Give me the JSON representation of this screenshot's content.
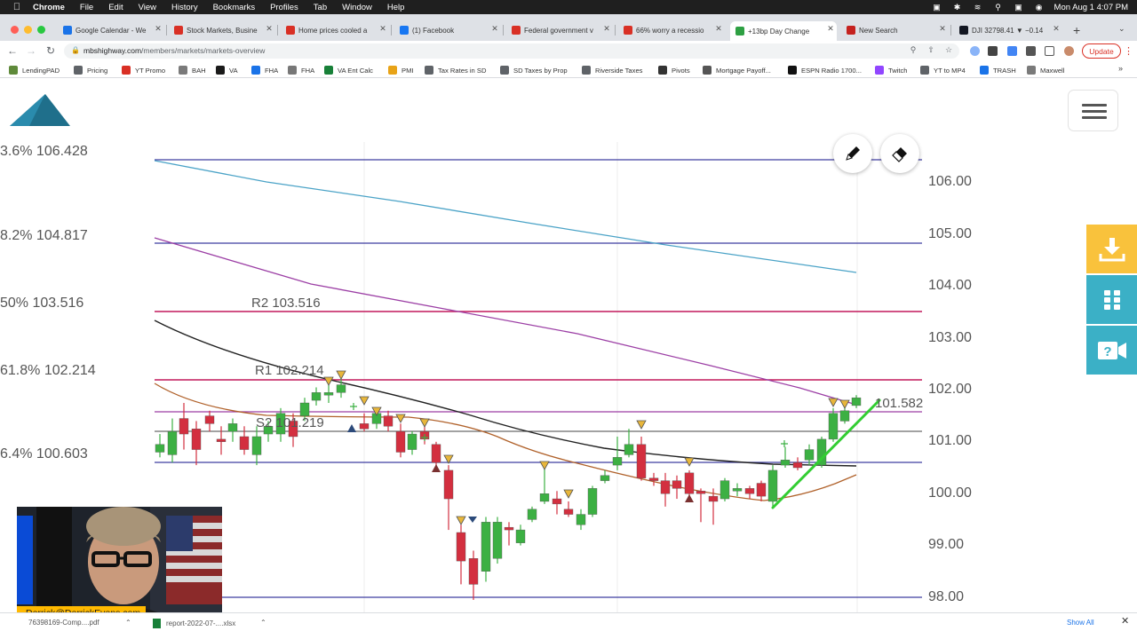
{
  "menubar": {
    "app": "Chrome",
    "items": [
      "File",
      "Edit",
      "View",
      "History",
      "Bookmarks",
      "Profiles",
      "Tab",
      "Window",
      "Help"
    ],
    "clock": "Mon Aug 1  4:07 PM"
  },
  "tabs": [
    {
      "label": "Google Calendar - We",
      "icon": "calendar-icon",
      "color": "#1a73e8"
    },
    {
      "label": "Stock Markets, Busine",
      "icon": "mbs-icon",
      "color": "#d93025"
    },
    {
      "label": "Home prices cooled a",
      "icon": "mbs-icon",
      "color": "#d93025"
    },
    {
      "label": "(1) Facebook",
      "icon": "facebook-icon",
      "color": "#1877f2"
    },
    {
      "label": "Federal government v",
      "icon": "mbs-icon",
      "color": "#d93025"
    },
    {
      "label": "66% worry a recessio",
      "icon": "mbs-icon",
      "color": "#d93025"
    },
    {
      "label": "+13bp Day Change",
      "icon": "house-icon",
      "color": "#2ea043"
    },
    {
      "label": "New Search",
      "icon": "search-house-icon",
      "color": "#c5221f"
    },
    {
      "label": "DJI 32798.41 ▼ −0.14",
      "icon": "tradingview-icon",
      "color": "#131722"
    }
  ],
  "active_tab_index": 6,
  "address": {
    "url_main": "mbshighway.com",
    "url_path": "/members/markets/markets-overview"
  },
  "update_label": "Update",
  "bookmarks": [
    {
      "label": "LendingPAD",
      "icon": "lendingpad-icon",
      "color": "#5f8a3a"
    },
    {
      "label": "Pricing",
      "icon": "globe-icon",
      "color": "#5f6368"
    },
    {
      "label": "YT Promo",
      "icon": "yt-promo-icon",
      "color": "#d93025"
    },
    {
      "label": "BAH",
      "icon": "folder-icon",
      "color": "#7a7a7a"
    },
    {
      "label": "VA",
      "icon": "va-icon",
      "color": "#1a1a1a"
    },
    {
      "label": "FHA",
      "icon": "house-icon",
      "color": "#1a73e8"
    },
    {
      "label": "FHA",
      "icon": "hud-icon",
      "color": "#777777"
    },
    {
      "label": "VA Ent Calc",
      "icon": "sheet-icon",
      "color": "#188038"
    },
    {
      "label": "PMI",
      "icon": "chart-icon",
      "color": "#e8a317"
    },
    {
      "label": "Tax Rates in SD",
      "icon": "globe-icon",
      "color": "#5f6368"
    },
    {
      "label": "SD Taxes by Prop",
      "icon": "globe-icon",
      "color": "#5f6368"
    },
    {
      "label": "Riverside Taxes",
      "icon": "circle-icon",
      "color": "#5f6368"
    },
    {
      "label": "Pivots",
      "icon": "pivots-icon",
      "color": "#333333"
    },
    {
      "label": "Mortgage Payoff...",
      "icon": "doc-icon",
      "color": "#555555"
    },
    {
      "label": "ESPN Radio 1700...",
      "icon": "v-icon",
      "color": "#111111"
    },
    {
      "label": "Twitch",
      "icon": "twitch-icon",
      "color": "#9146ff"
    },
    {
      "label": "YT to MP4",
      "icon": "globe-icon",
      "color": "#5f6368"
    },
    {
      "label": "TRASH",
      "icon": "cloud-icon",
      "color": "#1a73e8"
    },
    {
      "label": "Maxwell",
      "icon": "folder-icon",
      "color": "#7a7a7a"
    }
  ],
  "chart": {
    "fib_labels": [
      {
        "text": "3.6% 106.428"
      },
      {
        "text": "8.2% 104.817"
      },
      {
        "text": "50% 103.516"
      },
      {
        "text": "61.8% 102.214"
      },
      {
        "text": "6.4% 100.603"
      }
    ],
    "pivot_labels": {
      "r2": "R2 103.516",
      "r1": "R1 102.214",
      "s2": "S2 101.219"
    },
    "last_price": "101.582",
    "axis_ticks": [
      "106.00",
      "105.00",
      "104.00",
      "103.00",
      "102.00",
      "101.00",
      "100.00",
      "99.00",
      "98.00"
    ],
    "colors": {
      "up": "#3cb043",
      "down": "#d32f3f",
      "pivot_red": "#c2185b",
      "fib_purple": "#3f3da0",
      "ma_teal": "#4ba3c7",
      "ma_purple": "#9c3fa5",
      "ma_black": "#222222",
      "ma_brown": "#b0612a",
      "trendline": "#32cd32"
    }
  },
  "webcam": {
    "email": "Derrick@DerrickEvens.com"
  },
  "downloads": [
    {
      "label": "76398169-Comp....pdf"
    },
    {
      "label": "report-2022-07-....xlsx"
    }
  ],
  "show_all_label": "Show All"
}
